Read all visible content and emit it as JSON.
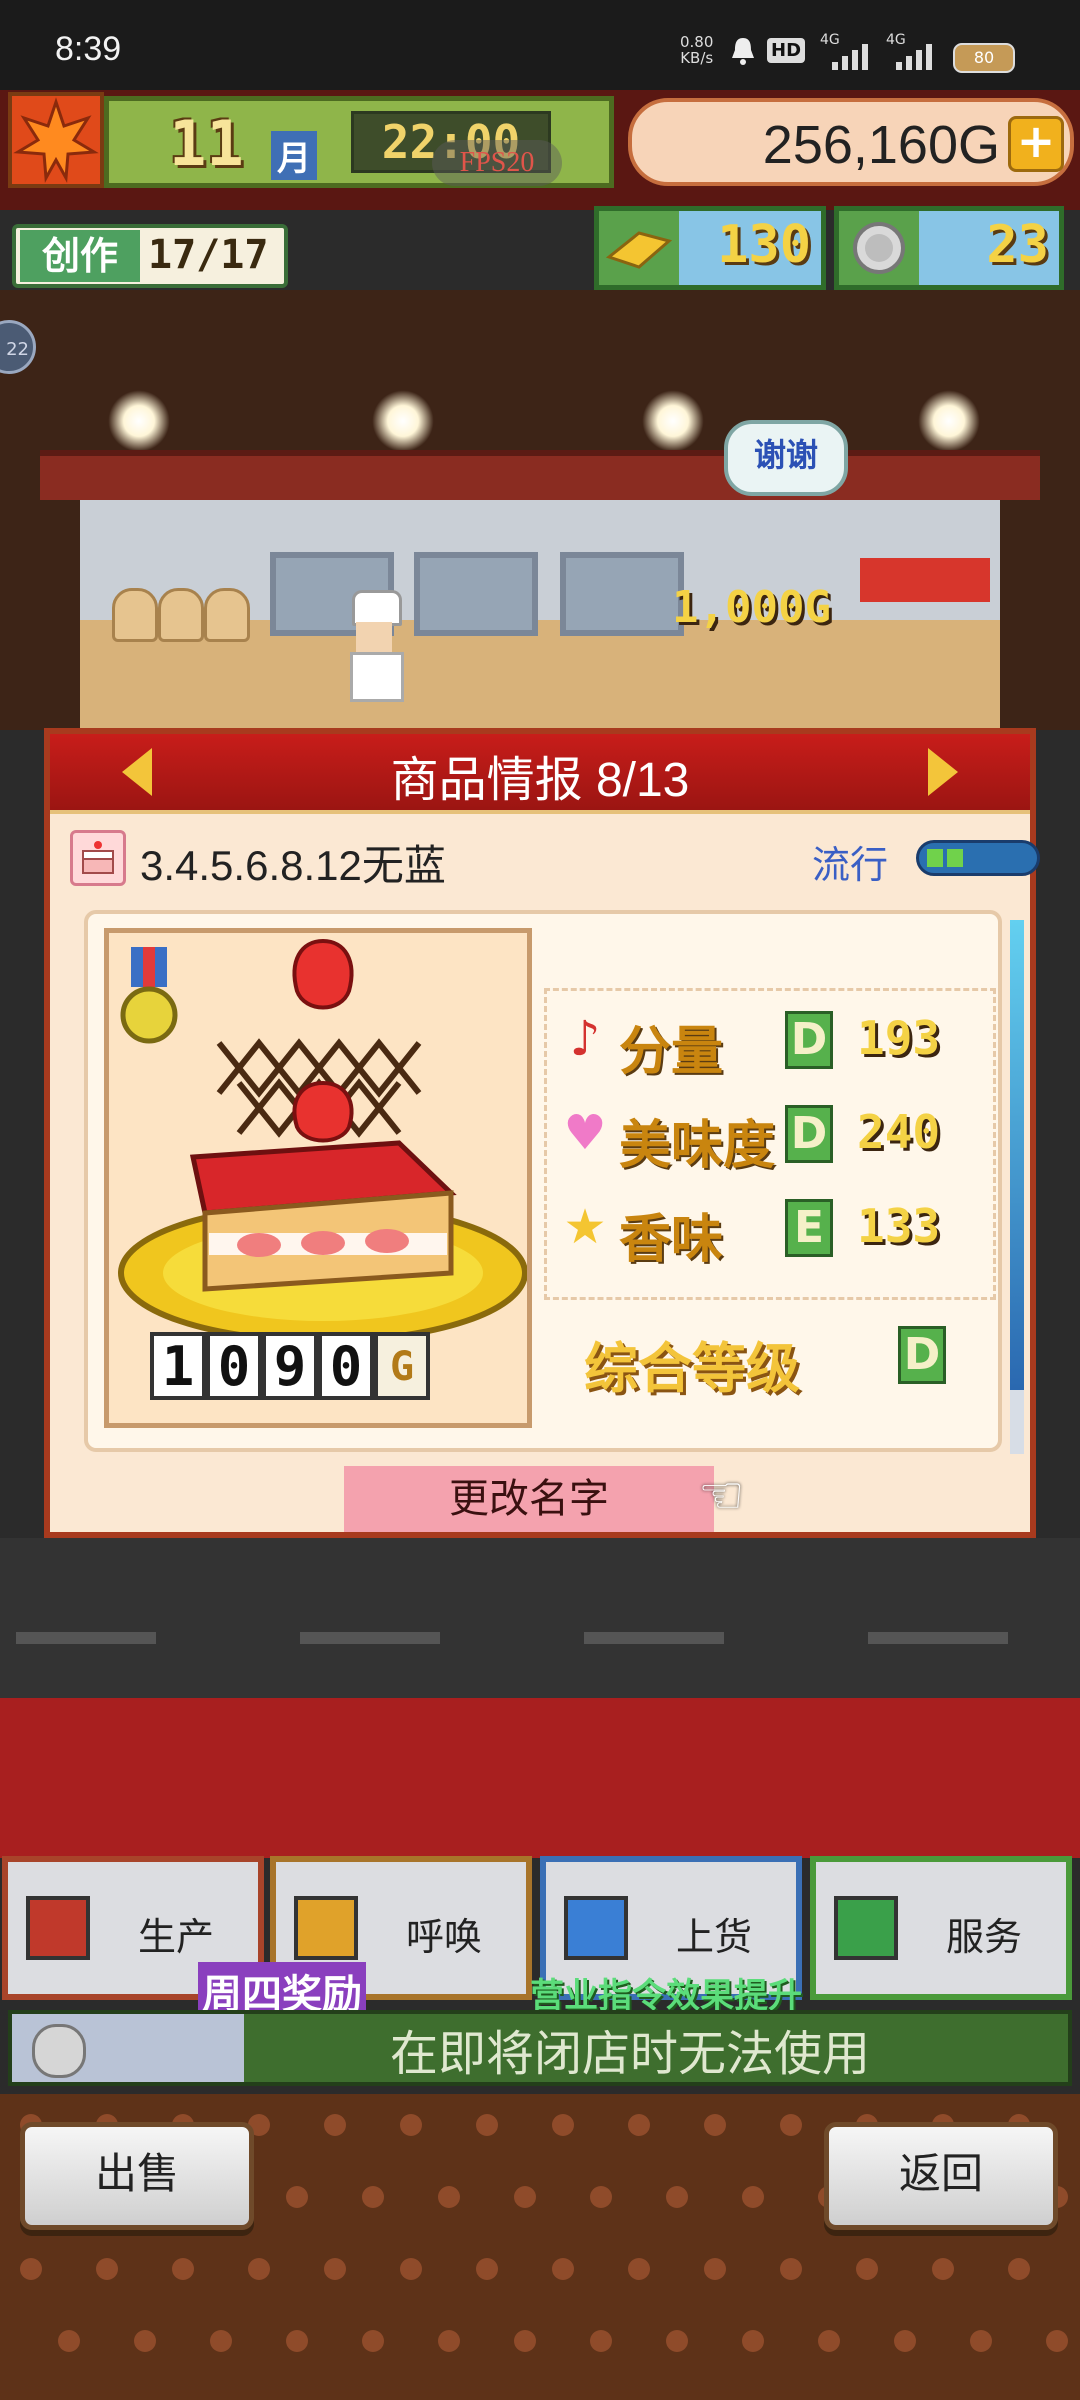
{
  "status_bar": {
    "time": "8:39",
    "net_speed_value": "0.80",
    "net_speed_unit": "KB/s",
    "hd_label": "HD",
    "signal1": "4G",
    "signal2": "4G",
    "battery": "80"
  },
  "hud": {
    "month_number": "11",
    "month_label": "月",
    "clock": "22:00",
    "fps": "FPS20",
    "money": "256,160G",
    "add_button": "+",
    "create_label": "创作",
    "create_count": "17/17",
    "gold_count": "130",
    "medal_count": "23",
    "side_badge": "22"
  },
  "scene": {
    "thanks_bubble": "谢谢",
    "floating_price": "1,000G"
  },
  "panel": {
    "title": "商品情报 8/13",
    "product_name": "3.4.5.6.8.12无蓝",
    "trend_label": "流行",
    "trend_level": 0.25,
    "price_digits": [
      "1",
      "0",
      "9",
      "0",
      "G"
    ],
    "stats": [
      {
        "icon": "music-note-icon",
        "label": "分量",
        "grade": "D",
        "value": "193"
      },
      {
        "icon": "heart-icon",
        "label": "美味度",
        "grade": "D",
        "value": "240"
      },
      {
        "icon": "star-icon",
        "label": "香味",
        "grade": "E",
        "value": "133"
      }
    ],
    "overall_label": "综合等级",
    "overall_grade": "D",
    "rename_button": "更改名字"
  },
  "actions": {
    "produce": "生产",
    "summon": "呼唤",
    "stock": "上货",
    "service": "服务",
    "promo_badge": "周四奖励",
    "promo_text": "营业指令效果提升",
    "disabled_notice": "在即将闭店时无法使用"
  },
  "bottom": {
    "sell_button": "出售",
    "back_button": "返回"
  },
  "colors": {
    "title_bar": "#c81d1a",
    "panel_bg": "#fbe8d3",
    "grade_green": "#56b14c",
    "stat_gold": "#c9850f"
  }
}
